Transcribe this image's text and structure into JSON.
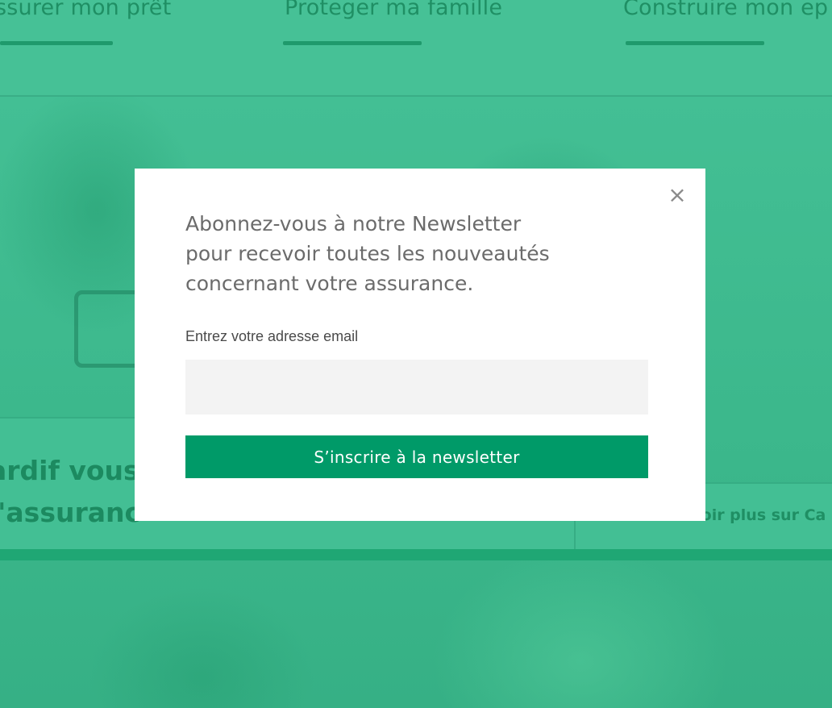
{
  "nav": {
    "items": [
      {
        "label": "ssurer mon prêt"
      },
      {
        "label": "Proteger ma famille"
      },
      {
        "label": "Construire mon ep"
      }
    ]
  },
  "hero": {
    "band_text_line1": "ardif vous",
    "band_text_line2": "l'assuranc",
    "side_link": "En savoir plus sur Ca"
  },
  "modal": {
    "heading_line1": "Abonnez-vous à notre Newsletter",
    "heading_line2": "pour recevoir toutes les nouveautés",
    "heading_line3": "concernant votre assurance.",
    "email_label": "Entrez votre adresse email",
    "email_value": "",
    "email_placeholder": "",
    "submit_label": "S’inscrire à la newsletter",
    "close_glyph": "×"
  },
  "colors": {
    "overlay_green": "#43bf94",
    "button_green": "#009a68",
    "modal_bg": "#ffffff",
    "input_bg": "#f3f3f3"
  },
  "icons": {
    "close": "close-icon"
  }
}
